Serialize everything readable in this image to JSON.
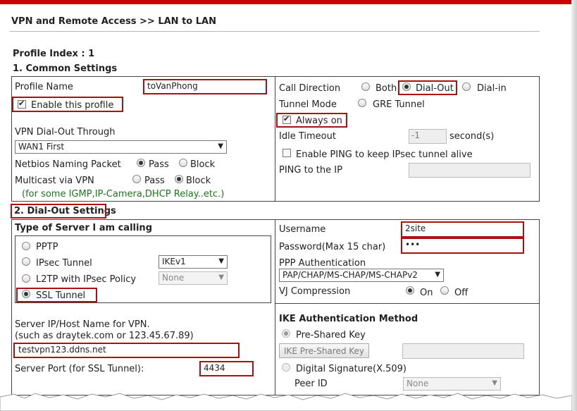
{
  "breadcrumb": "VPN and Remote Access >> LAN to LAN",
  "profile_index": "Profile Index : 1",
  "section1": "1. Common Settings",
  "section2": "2. Dial-Out Settings",
  "common": {
    "profile_name_label": "Profile Name",
    "profile_name_value": "toVanPhong",
    "enable_label": "Enable this profile",
    "vpn_dialout_label": "VPN Dial-Out Through",
    "vpn_dialout_value": "WAN1 First",
    "netbios_label": "Netbios Naming Packet",
    "pass_label": "Pass",
    "block_label": "Block",
    "multicast_label": "Multicast via VPN",
    "multicast_note": "(for some IGMP,IP-Camera,DHCP Relay..etc.)",
    "call_direction_label": "Call Direction",
    "both_label": "Both",
    "dialout_label": "Dial-Out",
    "dialin_label": "Dial-in",
    "tunnel_mode_label": "Tunnel Mode",
    "gre_label": "GRE Tunnel",
    "always_on_label": "Always on",
    "idle_timeout_label": "Idle Timeout",
    "idle_timeout_value": "-1",
    "seconds_label": "second(s)",
    "ping_enable_label": "Enable PING to keep IPsec tunnel alive",
    "ping_ip_label": "PING to the IP"
  },
  "dialout": {
    "server_type_label": "Type of Server I am calling",
    "pptp_label": "PPTP",
    "ipsec_label": "IPsec Tunnel",
    "ipsec_select": "IKEv1",
    "l2tp_label": "L2TP with IPsec Policy",
    "l2tp_select": "None",
    "ssl_label": "SSL Tunnel",
    "server_ip_label": "Server IP/Host Name for VPN.",
    "server_ip_hint": "(such as draytek.com or 123.45.67.89)",
    "server_ip_value": "testvpn123.ddns.net",
    "server_port_label": "Server Port (for SSL Tunnel):",
    "server_port_value": "4434",
    "username_label": "Username",
    "username_value": "2site",
    "password_label": "Password(Max 15 char)",
    "password_value": "•••",
    "ppp_auth_label": "PPP Authentication",
    "ppp_auth_value": "PAP/CHAP/MS-CHAP/MS-CHAPv2",
    "vj_label": "VJ Compression",
    "on_label": "On",
    "off_label": "Off",
    "ike_title": "IKE Authentication Method",
    "psk_label": "Pre-Shared Key",
    "psk_button": "IKE Pre-Shared Key",
    "digital_sig_label": "Digital Signature(X.509)",
    "peer_id_label": "Peer ID",
    "peer_id_value": "None"
  },
  "colors": {
    "accent": "#cc0000",
    "highlight_border": "#aa1111",
    "note_green": "#1a7a1a"
  }
}
